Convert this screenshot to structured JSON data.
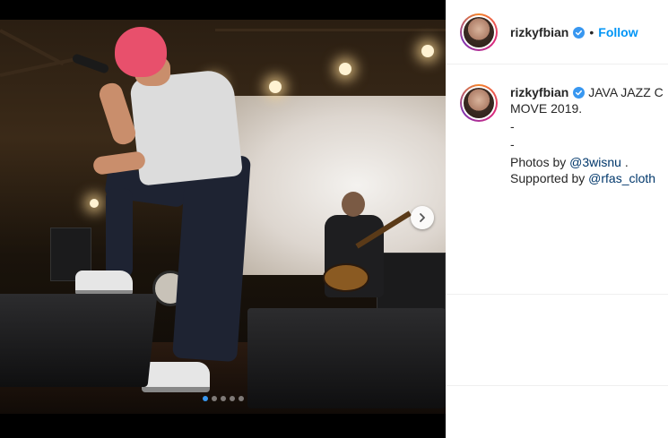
{
  "post": {
    "username": "rizkyfbian",
    "follow_label": "Follow",
    "separator": "•",
    "caption_lines": [
      "JAVA JAZZ C",
      "MOVE 2019.",
      "-",
      "-"
    ],
    "credits_photos_prefix": "Photos by ",
    "credits_photos_mention": "@3wisnu",
    "credits_photos_suffix": " .",
    "credits_supported_prefix": "Supported by ",
    "credits_supported_mention": "@rfas_cloth"
  },
  "carousel": {
    "dot_count": 5,
    "active_index": 0
  },
  "colors": {
    "follow": "#0095f6",
    "verified": "#3897f0",
    "mention": "#00376b"
  },
  "icons": {
    "verified": "verified-badge-icon",
    "next": "chevron-right-icon"
  }
}
